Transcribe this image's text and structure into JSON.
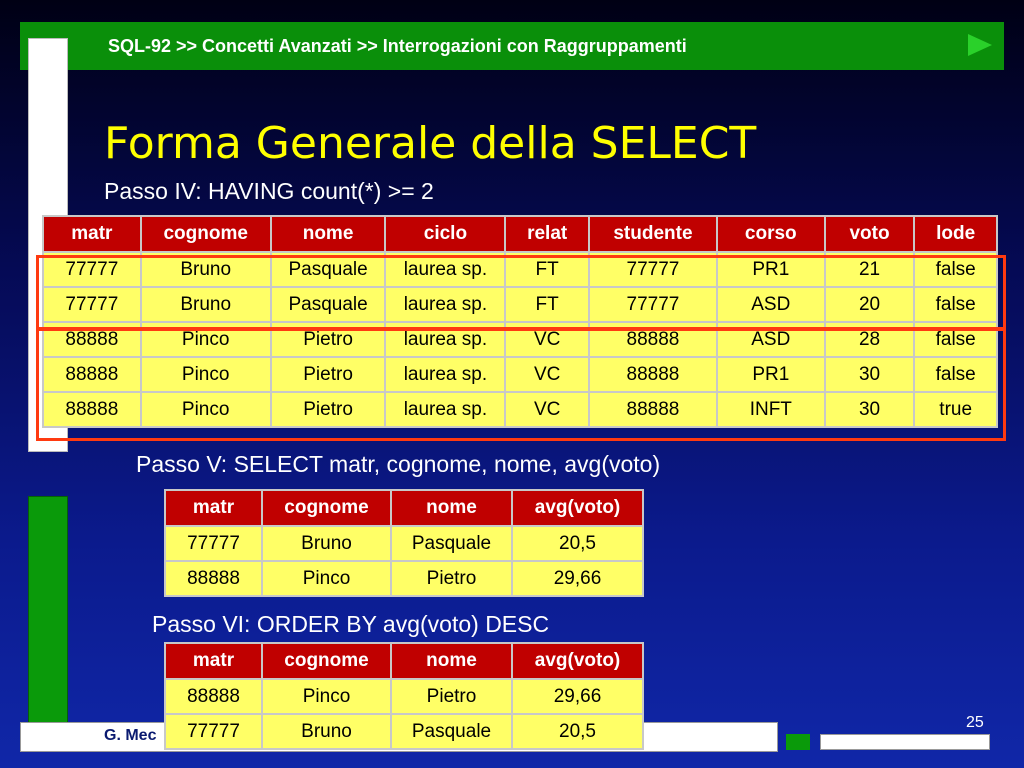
{
  "header": {
    "breadcrumb": "SQL-92 >> Concetti Avanzati >> Interrogazioni con Raggruppamenti"
  },
  "title": "Forma Generale della SELECT",
  "steps": {
    "step4": "Passo IV: HAVING count(*) >= 2",
    "step5": "Passo V: SELECT matr, cognome, nome, avg(voto)",
    "step6": "Passo VI: ORDER BY avg(voto) DESC"
  },
  "main_table": {
    "columns": [
      "matr",
      "cognome",
      "nome",
      "ciclo",
      "relat",
      "studente",
      "corso",
      "voto",
      "lode"
    ],
    "rows": [
      [
        "77777",
        "Bruno",
        "Pasquale",
        "laurea sp.",
        "FT",
        "77777",
        "PR1",
        "21",
        "false"
      ],
      [
        "77777",
        "Bruno",
        "Pasquale",
        "laurea sp.",
        "FT",
        "77777",
        "ASD",
        "20",
        "false"
      ],
      [
        "88888",
        "Pinco",
        "Pietro",
        "laurea sp.",
        "VC",
        "88888",
        "ASD",
        "28",
        "false"
      ],
      [
        "88888",
        "Pinco",
        "Pietro",
        "laurea sp.",
        "VC",
        "88888",
        "PR1",
        "30",
        "false"
      ],
      [
        "88888",
        "Pinco",
        "Pietro",
        "laurea sp.",
        "VC",
        "88888",
        "INFT",
        "30",
        "true"
      ]
    ]
  },
  "table_step5": {
    "columns": [
      "matr",
      "cognome",
      "nome",
      "avg(voto)"
    ],
    "rows": [
      [
        "77777",
        "Bruno",
        "Pasquale",
        "20,5"
      ],
      [
        "88888",
        "Pinco",
        "Pietro",
        "29,66"
      ]
    ]
  },
  "table_step6": {
    "columns": [
      "matr",
      "cognome",
      "nome",
      "avg(voto)"
    ],
    "rows": [
      [
        "88888",
        "Pinco",
        "Pietro",
        "29,66"
      ],
      [
        "77777",
        "Bruno",
        "Pasquale",
        "20,5"
      ]
    ]
  },
  "footer": {
    "author": "G. Mec",
    "page": "25"
  },
  "colors": {
    "header_green": "#0a8f0a",
    "title_yellow": "#ffff00",
    "table_header_red": "#c00000",
    "table_cell_yellow": "#ffff66",
    "highlight_red": "#ff3a10"
  }
}
